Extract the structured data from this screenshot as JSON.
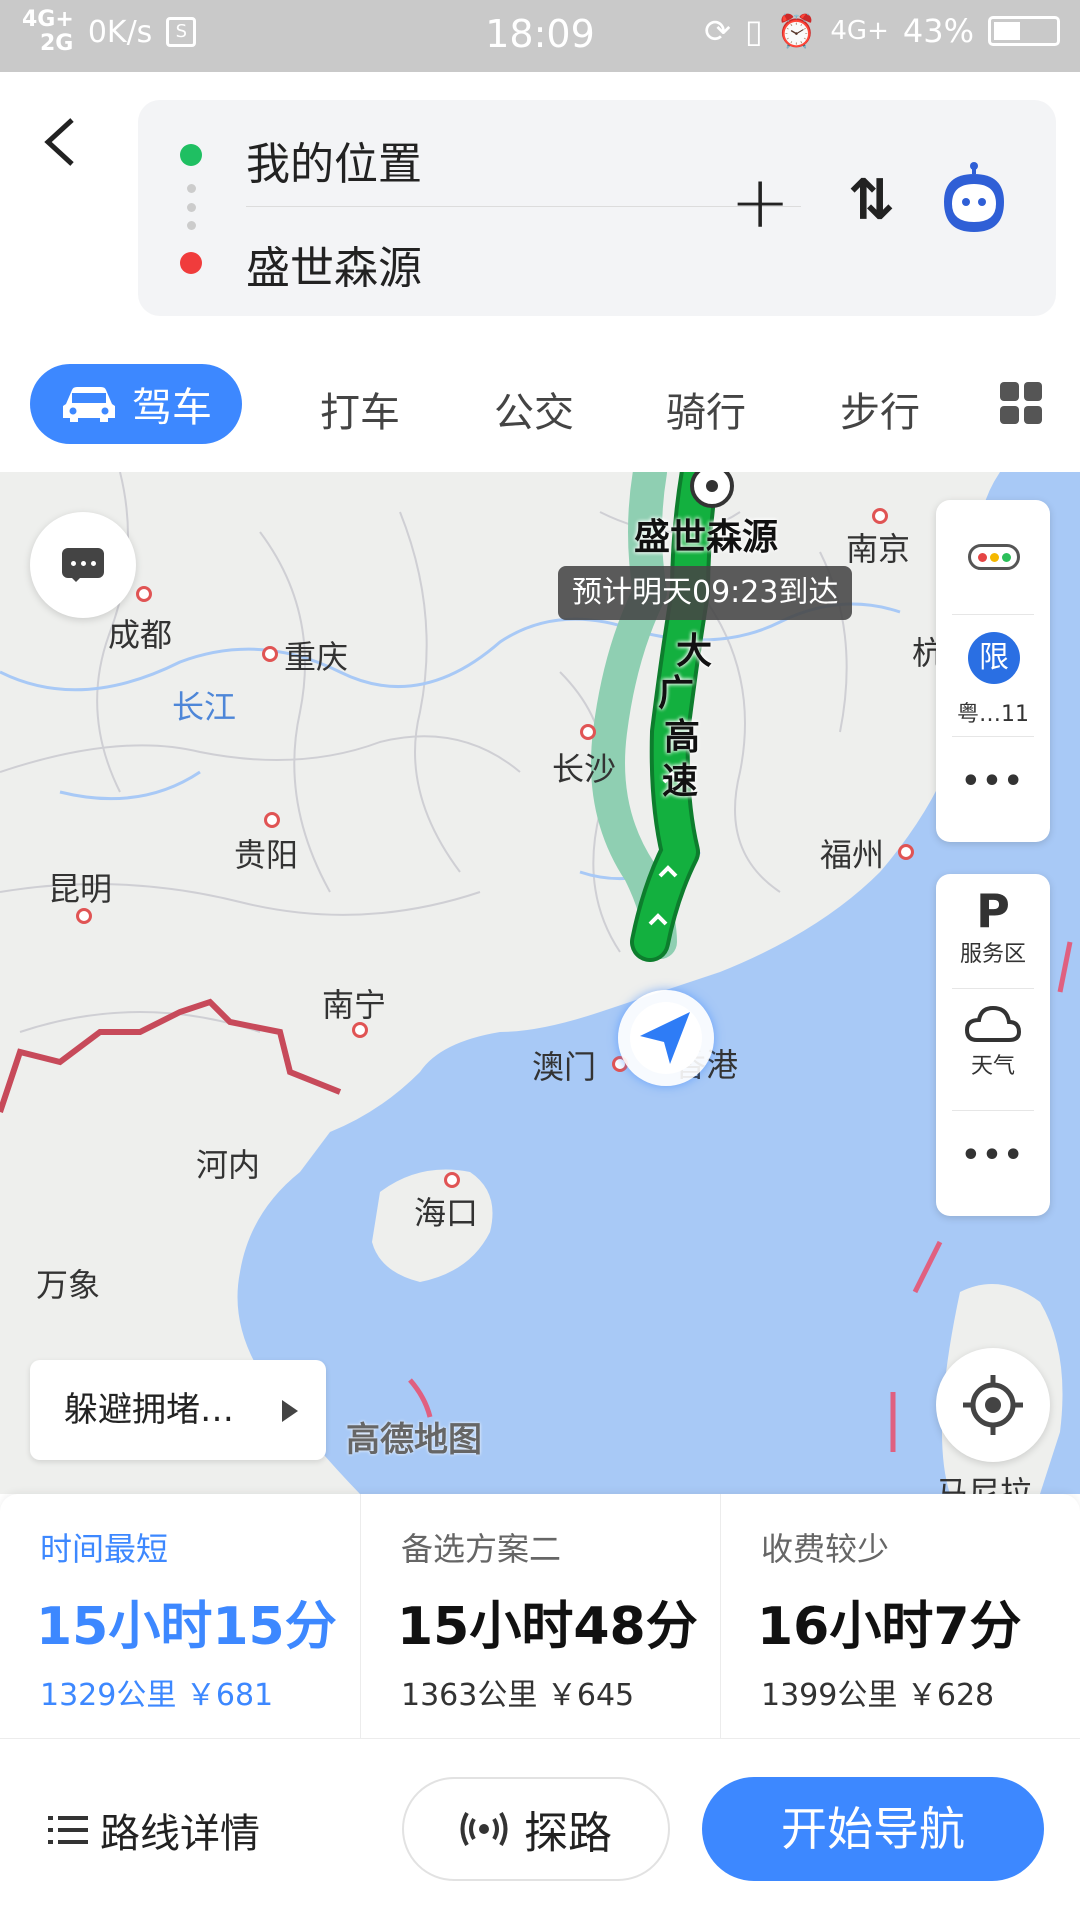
{
  "status_bar": {
    "network_top": "4G+",
    "network_bottom": "2G",
    "speed": "0K/s",
    "time": "18:09",
    "network_right": "4G+",
    "battery": "43%",
    "battery_level": 0.43
  },
  "route": {
    "from": "我的位置",
    "to": "盛世森源"
  },
  "modes": {
    "active": "驾车",
    "items": [
      "打车",
      "公交",
      "骑行",
      "步行"
    ]
  },
  "map": {
    "destination": "盛世森源",
    "eta": "预计明天09:23到达",
    "road_name": [
      "大",
      "广",
      "高",
      "速"
    ],
    "cities": {
      "nanjing": "南京",
      "chengdu": "成都",
      "chongqing": "重庆",
      "changjiang": "长江",
      "changsha": "长沙",
      "guiyang": "贵阳",
      "fuzhou": "福州",
      "kunming": "昆明",
      "nanning": "南宁",
      "macau": "澳门",
      "hongkong": "香港",
      "hanoi": "河内",
      "haikou": "海口",
      "vientiane": "万象",
      "hang": "杭",
      "manila_partial": "马尼拉"
    },
    "limit_icon": "限",
    "limit_plate": "粤…11",
    "service_area": "服务区",
    "weather": "天气",
    "avoid_congestion": "躲避拥堵…",
    "watermark": "高德地图",
    "route_colors": {
      "main": "#13b03f",
      "alt": "#8fcfb2",
      "water": "#a8c9f6",
      "land": "#eeefed"
    }
  },
  "options": [
    {
      "tag": "时间最短",
      "duration": "15小时15分",
      "meta": "1329公里 ￥681"
    },
    {
      "tag": "备选方案二",
      "duration": "15小时48分",
      "meta": "1363公里 ￥645"
    },
    {
      "tag": "收费较少",
      "duration": "16小时7分",
      "meta": "1399公里 ￥628"
    }
  ],
  "bottom": {
    "detail": "路线详情",
    "probe": "探路",
    "start": "开始导航"
  }
}
